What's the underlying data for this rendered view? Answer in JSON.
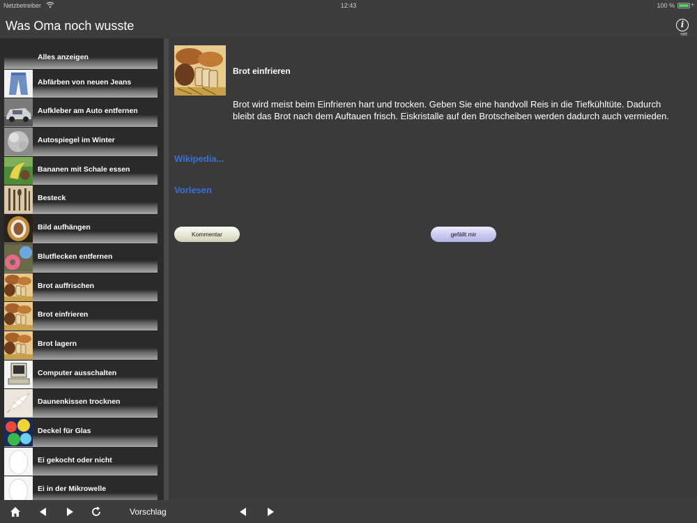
{
  "status": {
    "carrier": "Netzbetreiber",
    "time": "12:43",
    "battery": "100 %",
    "battery_level": 1.0
  },
  "nav": {
    "title": "Was Oma noch wusste",
    "info_label": "net"
  },
  "sidebar": {
    "items": [
      {
        "label": "Alles anzeigen",
        "icon": "none"
      },
      {
        "label": "Abfärben von neuen Jeans",
        "icon": "jeans-thumb"
      },
      {
        "label": "Aufkleber am Auto entfernen",
        "icon": "car-thumb"
      },
      {
        "label": "Autospiegel im Winter",
        "icon": "frost-thumb"
      },
      {
        "label": "Bananen mit Schale essen",
        "icon": "banana-thumb"
      },
      {
        "label": "Besteck",
        "icon": "cutlery-thumb"
      },
      {
        "label": "Bild aufhängen",
        "icon": "frame-thumb"
      },
      {
        "label": "Blutflecken entfernen",
        "icon": "donut-thumb"
      },
      {
        "label": "Brot auffrischen",
        "icon": "bread-thumb"
      },
      {
        "label": "Brot einfrieren",
        "icon": "bread-thumb"
      },
      {
        "label": "Brot lagern",
        "icon": "bread-thumb"
      },
      {
        "label": "Computer ausschalten",
        "icon": "computer-thumb"
      },
      {
        "label": "Daunenkissen trocknen",
        "icon": "feather-thumb"
      },
      {
        "label": "Deckel für Glas",
        "icon": "glass-thumb"
      },
      {
        "label": "Ei gekocht oder nicht",
        "icon": "egg-thumb"
      },
      {
        "label": "Ei in der Mikrowelle",
        "icon": "egg-thumb"
      }
    ]
  },
  "detail": {
    "title": "Brot einfrieren",
    "text": "Brot wird meist beim Einfrieren hart und trocken. Geben Sie eine handvoll Reis in die Tiefkühltüte. Dadurch bleibt das Brot nach dem Auftauen frisch. Eiskristalle auf den Brotscheiben werden dadurch auch vermieden.",
    "wikipedia_link": "Wikipedia...",
    "read_aloud_link": "Vorlesen",
    "comment_button": "Kommentar",
    "like_button": "gefällt mir"
  },
  "toolbar": {
    "suggestion_label": "Vorschlag"
  },
  "colors": {
    "background": "#3a3a3a",
    "sidebar": "#2b2b2b",
    "link": "#3a6fd8"
  }
}
